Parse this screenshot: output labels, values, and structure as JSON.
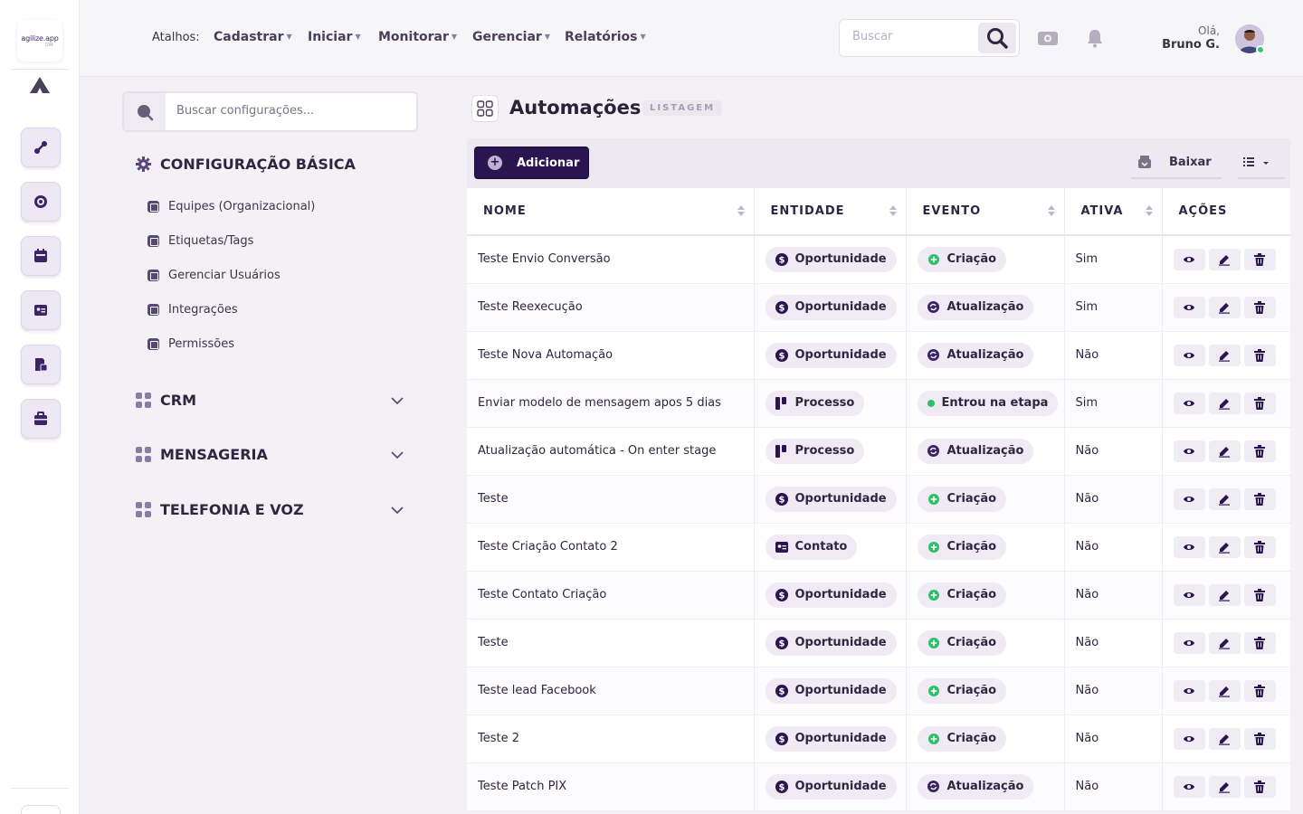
{
  "rail": {
    "logo_text": "agilize.app",
    "logo_sub": "CRM"
  },
  "topbar": {
    "shortcuts_label": "Atalhos:",
    "nav": [
      "Cadastrar",
      "Iniciar",
      "Monitorar",
      "Gerenciar",
      "Relatórios"
    ],
    "search_placeholder": "Buscar",
    "greeting": "Olá,",
    "user_name": "Bruno G."
  },
  "settings": {
    "search_placeholder": "Buscar configurações...",
    "basic_title": "CONFIGURAÇÃO BÁSICA",
    "basic_items": [
      "Equipes (Organizacional)",
      "Etiquetas/Tags",
      "Gerenciar Usuários",
      "Integrações",
      "Permissões"
    ],
    "sections": [
      "CRM",
      "MENSAGERIA",
      "TELEFONIA E VOZ"
    ]
  },
  "page": {
    "title": "Automações",
    "badge": "LISTAGEM",
    "add_label": "Adicionar",
    "download_label": "Baixar"
  },
  "table": {
    "columns": [
      "NOME",
      "ENTIDADE",
      "EVENTO",
      "ATIVA",
      "AÇÕES"
    ],
    "rows": [
      {
        "name": "Teste Envio Conversão",
        "entity": "Oportunidade",
        "event": "Criação",
        "active": "Sim"
      },
      {
        "name": "Teste Reexecução",
        "entity": "Oportunidade",
        "event": "Atualização",
        "active": "Sim"
      },
      {
        "name": "Teste Nova Automação",
        "entity": "Oportunidade",
        "event": "Atualização",
        "active": "Não"
      },
      {
        "name": "Enviar modelo de mensagem apos 5 dias",
        "entity": "Processo",
        "event": "Entrou na etapa",
        "active": "Sim"
      },
      {
        "name": "Atualização automática - On enter stage",
        "entity": "Processo",
        "event": "Atualização",
        "active": "Não"
      },
      {
        "name": "Teste",
        "entity": "Oportunidade",
        "event": "Criação",
        "active": "Não"
      },
      {
        "name": "Teste Criação Contato 2",
        "entity": "Contato",
        "event": "Criação",
        "active": "Não"
      },
      {
        "name": "Teste Contato Criação",
        "entity": "Oportunidade",
        "event": "Criação",
        "active": "Não"
      },
      {
        "name": "Teste",
        "entity": "Oportunidade",
        "event": "Criação",
        "active": "Não"
      },
      {
        "name": "Teste lead Facebook",
        "entity": "Oportunidade",
        "event": "Criação",
        "active": "Não"
      },
      {
        "name": "Teste 2",
        "entity": "Oportunidade",
        "event": "Criação",
        "active": "Não"
      },
      {
        "name": "Teste Patch PIX",
        "entity": "Oportunidade",
        "event": "Atualização",
        "active": "Não"
      }
    ]
  },
  "colors": {
    "primary": "#2b1550",
    "accent": "#5b4679",
    "creation": "#2fbf6a",
    "update": "#3d2466",
    "online": "#39c27a"
  }
}
